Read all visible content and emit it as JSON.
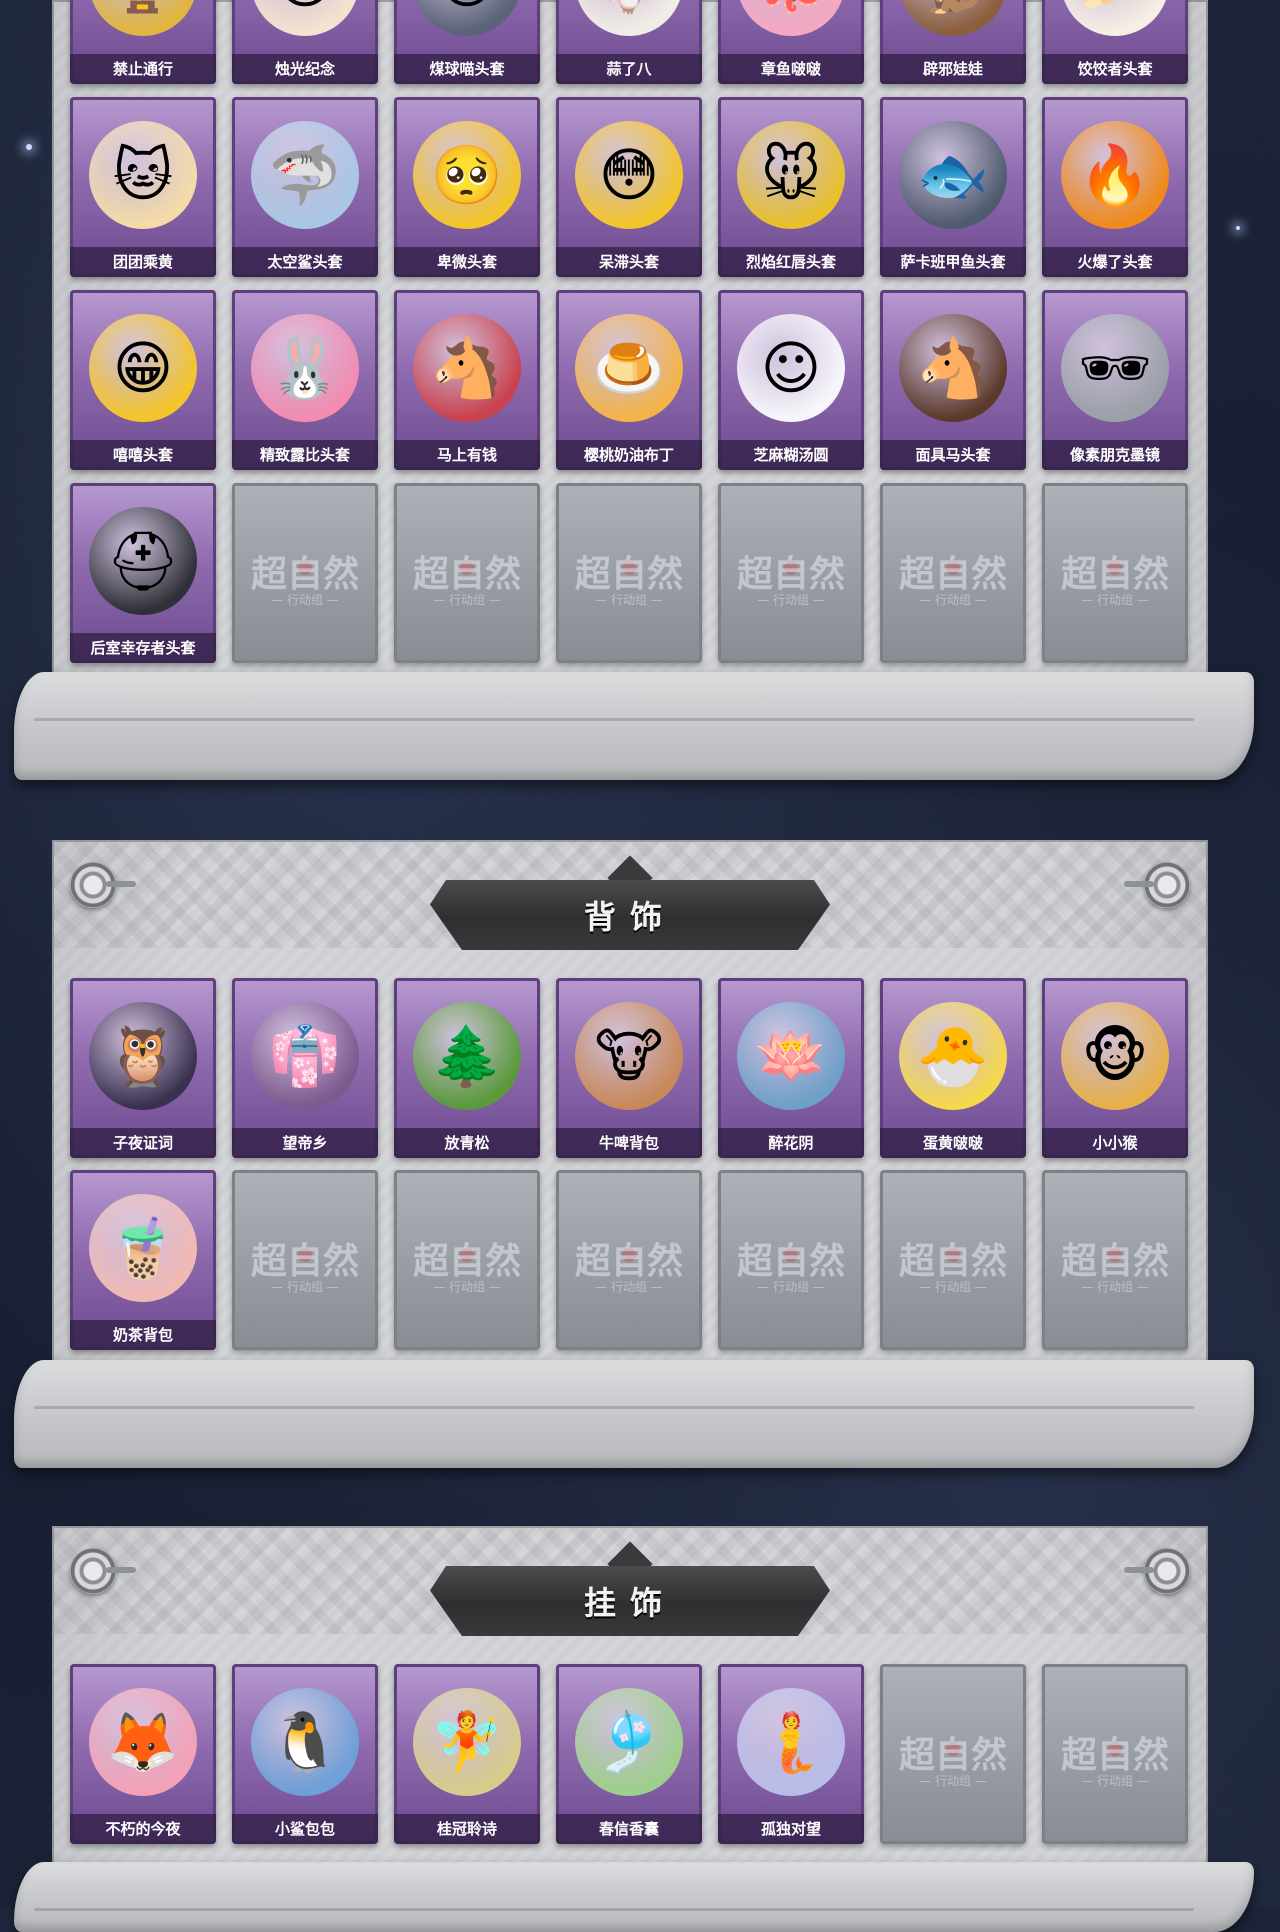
{
  "sections": [
    {
      "id": "headwear",
      "title": "",
      "items": [
        {
          "label": "禁止通行",
          "icon": "🏆",
          "tone": "#e0b640"
        },
        {
          "label": "烛光纪念",
          "icon": "😌",
          "tone": "#f3e2cf"
        },
        {
          "label": "煤球喵头套",
          "icon": "🐱",
          "tone": "#5a6378"
        },
        {
          "label": "蒜了八",
          "icon": "🧄",
          "tone": "#f1ede6"
        },
        {
          "label": "章鱼啵啵",
          "icon": "🐙",
          "tone": "#f5a8c2"
        },
        {
          "label": "辟邪娃娃",
          "icon": "🐒",
          "tone": "#8b5f3c"
        },
        {
          "label": "饺饺者头套",
          "icon": "🥟",
          "tone": "#f6efe4"
        },
        {
          "label": "团团乘黄",
          "icon": "🐱",
          "tone": "#f4dba8"
        },
        {
          "label": "太空鲨头套",
          "icon": "🦈",
          "tone": "#a9c7e4"
        },
        {
          "label": "卑微头套",
          "icon": "🥺",
          "tone": "#f4c52a"
        },
        {
          "label": "呆滞头套",
          "icon": "😳",
          "tone": "#f4c52a"
        },
        {
          "label": "烈焰红唇头套",
          "icon": "🐭",
          "tone": "#e7c02b"
        },
        {
          "label": "萨卡班甲鱼头套",
          "icon": "🐟",
          "tone": "#4f5b6e"
        },
        {
          "label": "火爆了头套",
          "icon": "🔥",
          "tone": "#f08a1c"
        },
        {
          "label": "嘻嘻头套",
          "icon": "😁",
          "tone": "#f4c52a"
        },
        {
          "label": "精致露比头套",
          "icon": "🐰",
          "tone": "#f28cb1"
        },
        {
          "label": "马上有钱",
          "icon": "🐴",
          "tone": "#c9424d"
        },
        {
          "label": "樱桃奶油布丁",
          "icon": "🍮",
          "tone": "#f3b44a"
        },
        {
          "label": "芝麻糊汤圆",
          "icon": "☺",
          "tone": "#f7f7fb"
        },
        {
          "label": "面具马头套",
          "icon": "🐴",
          "tone": "#5b3a2b"
        },
        {
          "label": "像素朋克墨镜",
          "icon": "🕶",
          "tone": "#9aa0a8"
        },
        {
          "label": "后室幸存者头套",
          "icon": "⛑",
          "tone": "#2e3138"
        },
        {
          "label": "",
          "empty": true
        },
        {
          "label": "",
          "empty": true
        },
        {
          "label": "",
          "empty": true
        },
        {
          "label": "",
          "empty": true
        },
        {
          "label": "",
          "empty": true
        },
        {
          "label": "",
          "empty": true
        }
      ]
    },
    {
      "id": "back",
      "title": "背饰",
      "items": [
        {
          "label": "子夜证词",
          "icon": "🦉",
          "tone": "#3a3150"
        },
        {
          "label": "望帝乡",
          "icon": "👘",
          "tone": "#7b5a8e"
        },
        {
          "label": "放青松",
          "icon": "🌲",
          "tone": "#5a9a3c"
        },
        {
          "label": "牛啤背包",
          "icon": "🐮",
          "tone": "#c8895a"
        },
        {
          "label": "醉花阴",
          "icon": "🪷",
          "tone": "#6fa0c8"
        },
        {
          "label": "蛋黄啵啵",
          "icon": "🐣",
          "tone": "#f5d74c"
        },
        {
          "label": "小小猴",
          "icon": "🐵",
          "tone": "#e6b04a"
        },
        {
          "label": "奶茶背包",
          "icon": "🧋",
          "tone": "#f1b9b4"
        },
        {
          "label": "",
          "empty": true
        },
        {
          "label": "",
          "empty": true
        },
        {
          "label": "",
          "empty": true
        },
        {
          "label": "",
          "empty": true
        },
        {
          "label": "",
          "empty": true
        },
        {
          "label": "",
          "empty": true
        }
      ]
    },
    {
      "id": "pendant",
      "title": "挂饰",
      "items": [
        {
          "label": "不朽的今夜",
          "icon": "🦊",
          "tone": "#f3a2b6"
        },
        {
          "label": "小鲨包包",
          "icon": "🐧",
          "tone": "#6e9fd6"
        },
        {
          "label": "桂冠聆诗",
          "icon": "🧚",
          "tone": "#d6cc8a"
        },
        {
          "label": "春信香囊",
          "icon": "🎐",
          "tone": "#9fcf8c"
        },
        {
          "label": "孤独对望",
          "icon": "🧜",
          "tone": "#b8bde8"
        },
        {
          "label": "",
          "empty": true
        },
        {
          "label": "",
          "empty": true
        }
      ]
    }
  ],
  "empty_card": {
    "logo": "超自然",
    "sub": "— 行动组 —"
  },
  "colors": {
    "card_purple": "#8f6aaf",
    "card_empty": "#969aa1",
    "panel": "#d2d3d6",
    "banner": "#2f2f32"
  }
}
